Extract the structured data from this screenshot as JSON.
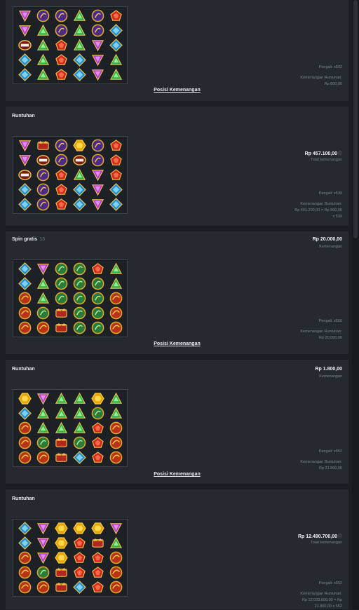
{
  "labels": {
    "winning_positions": "Posisi Kemenangan",
    "winning": "Kemenangan",
    "total_winning": "Total kemenangan",
    "info_mark": "ⓘ"
  },
  "colors": {
    "background": "#1a1f23",
    "panel": "#242a2f",
    "text": "#e9ecef",
    "muted": "#7d868f"
  },
  "legend": {
    "P": "purple-triangle-gem",
    "G": "green-triangle-gem",
    "R": "red-pentagon-gem",
    "B": "blue-diamond-gem",
    "Y": "yellow-hexagon-gem",
    "U": "purple-ring-symbol",
    "O": "red-orange-ring-symbol",
    "N": "green-ring-symbol",
    "C": "crown-symbol",
    "X": "multiplier-symbol"
  },
  "panels": [
    {
      "title": "",
      "count": "",
      "amount": "",
      "amount_sub": "",
      "multiplier_label": "",
      "grid": [
        [
          "P",
          "U",
          "U",
          "G",
          "U",
          "R"
        ],
        [
          "P",
          "G",
          "U",
          "G",
          "U",
          "B"
        ],
        [
          "X",
          "G",
          "R",
          "G",
          "P",
          "B"
        ],
        [
          "B",
          "G",
          "R",
          "B",
          "P",
          "G"
        ],
        [
          "B",
          "G",
          "R",
          "B",
          "P",
          "G"
        ]
      ],
      "meta_lines": [
        "Pengali: x502",
        "",
        "Kemenangan Runtuhan:",
        "Rp 800,00"
      ],
      "show_winpos": true
    },
    {
      "title": "Runtuhan",
      "count": "",
      "amount": "Rp 457.100,00",
      "amount_sub": "Total kemenangan",
      "multiplier_label": "",
      "grid": [
        [
          "P",
          "C",
          "U",
          "Y",
          "U",
          "R"
        ],
        [
          "P",
          "X",
          "U",
          "X",
          "U",
          "R"
        ],
        [
          "X",
          "U",
          "R",
          "G",
          "P",
          "R"
        ],
        [
          "B",
          "U",
          "R",
          "B",
          "P",
          "B"
        ],
        [
          "B",
          "U",
          "R",
          "B",
          "P",
          "B"
        ]
      ],
      "meta_lines": [
        "Pengali: x539",
        "",
        "Kemenangan Runtuhan:",
        "Rp 401.200,00 = Rp 800,00",
        "x 539"
      ],
      "show_winpos": false
    },
    {
      "title": "Spin gratis",
      "count": "13",
      "amount": "Rp 20.000,00",
      "amount_sub": "Kemenangan",
      "multiplier_label": "",
      "grid": [
        [
          "B",
          "P",
          "N",
          "N",
          "R",
          "G"
        ],
        [
          "B",
          "G",
          "N",
          "N",
          "N",
          "G"
        ],
        [
          "O",
          "G",
          "N",
          "N",
          "N",
          "O"
        ],
        [
          "O",
          "N",
          "C",
          "N",
          "N",
          "O"
        ],
        [
          "O",
          "O",
          "C",
          "N",
          "N",
          "O"
        ]
      ],
      "meta_lines": [
        "Pengali: x550",
        "",
        "Kemenangan Runtuhan:",
        "Rp 20.000,00"
      ],
      "show_winpos": true
    },
    {
      "title": "Runtuhan",
      "count": "",
      "amount": "Rp 1.800,00",
      "amount_sub": "Kemenangan",
      "multiplier_label": "",
      "grid": [
        [
          "Y",
          "P",
          "G",
          "G",
          "Y",
          "G"
        ],
        [
          "B",
          "G",
          "G",
          "G",
          "N",
          "G"
        ],
        [
          "O",
          "G",
          "G",
          "G",
          "R",
          "O"
        ],
        [
          "O",
          "N",
          "C",
          "N",
          "R",
          "O"
        ],
        [
          "O",
          "O",
          "C",
          "B",
          "R",
          "O"
        ]
      ],
      "meta_lines": [
        "Pengali: x552",
        "",
        "Kemenangan Runtuhan:",
        "Rp 21.800,00"
      ],
      "show_winpos": true
    },
    {
      "title": "Runtuhan",
      "count": "",
      "amount": "Rp 12.490.700,00",
      "amount_sub": "Total kemenangan",
      "multiplier_label": "",
      "grid": [
        [
          "B",
          "P",
          "Y",
          "Y",
          "Y",
          "P"
        ],
        [
          "B",
          "P",
          "Y",
          "R",
          "C",
          "G"
        ],
        [
          "O",
          "P",
          "Y",
          "R",
          "R",
          "O"
        ],
        [
          "O",
          "N",
          "C",
          "R",
          "R",
          "O"
        ],
        [
          "O",
          "O",
          "C",
          "B",
          "R",
          "O"
        ]
      ],
      "meta_lines": [
        "Pengali: x552",
        "",
        "Kemenangan Runtuhan:",
        "Rp 12.033.600,00 = Rp",
        "21.800,00 x 552"
      ],
      "show_winpos": false
    }
  ]
}
